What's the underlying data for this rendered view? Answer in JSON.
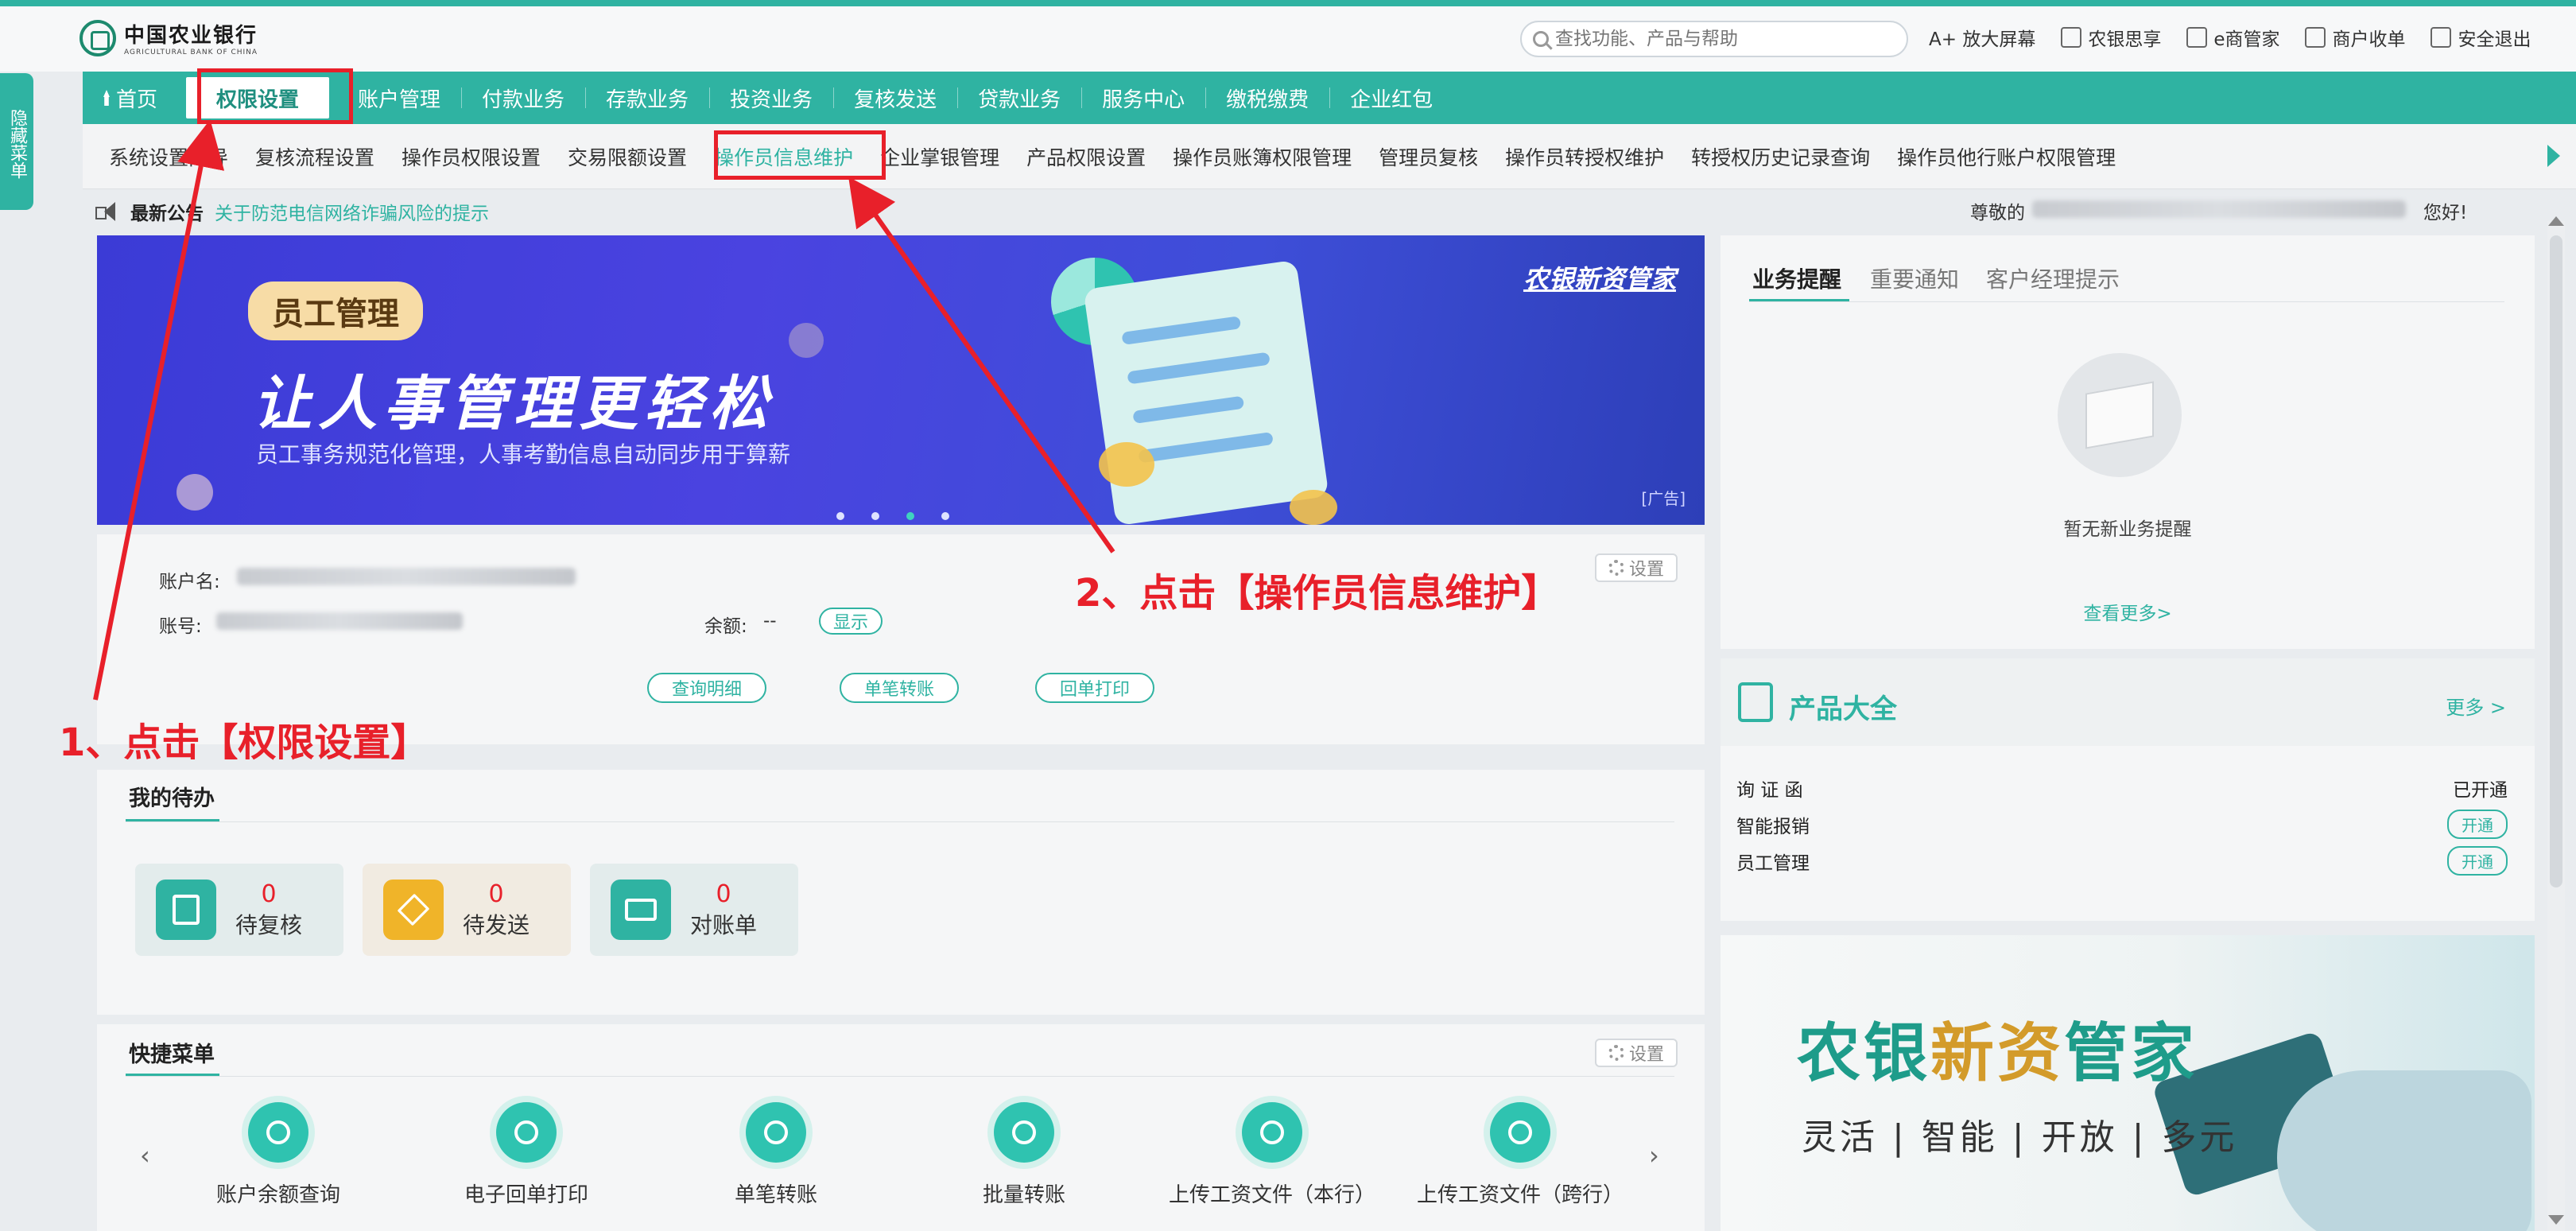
{
  "header": {
    "logo_cn": "中国农业银行",
    "logo_en": "AGRICULTURAL BANK OF CHINA",
    "search_placeholder": "查找功能、产品与帮助",
    "tools": [
      {
        "icon": "font-size-icon",
        "label": "A+ 放大屏幕"
      },
      {
        "icon": "share-icon",
        "label": "农银思享"
      },
      {
        "icon": "e-manager-icon",
        "label": "e商管家"
      },
      {
        "icon": "merchant-icon",
        "label": "商户收单"
      },
      {
        "icon": "logout-icon",
        "label": "安全退出"
      }
    ]
  },
  "side_tab": {
    "label": "隐藏菜单",
    "arrow": "︿"
  },
  "nav": {
    "items": [
      "首页",
      "权限设置",
      "账户管理",
      "付款业务",
      "存款业务",
      "投资业务",
      "复核发送",
      "贷款业务",
      "服务中心",
      "缴税缴费",
      "企业红包"
    ],
    "active_index": 1
  },
  "subnav": {
    "items": [
      "系统设置向导",
      "复核流程设置",
      "操作员权限设置",
      "交易限额设置",
      "操作员信息维护",
      "企业掌银管理",
      "产品权限设置",
      "操作员账簿权限管理",
      "管理员复核",
      "操作员转授权维护",
      "转授权历史记录查询",
      "操作员他行账户权限管理"
    ],
    "active_index": 4
  },
  "notice": {
    "title": "最新公告",
    "text": "关于防范电信网络诈骗风险的提示"
  },
  "banner": {
    "tag": "员工管理",
    "headline": "让人事管理更轻松",
    "subtitle": "员工事务规范化管理，人事考勤信息自动同步用于算薪",
    "brand": "农银新资管家",
    "ad": "[广告]",
    "dots": 4,
    "active_dot": 2
  },
  "account": {
    "name_label": "账户名:",
    "number_label": "账号:",
    "balance_label": "余额:",
    "balance_value": "--",
    "show_label": "显示",
    "settings_label": "设置",
    "buttons": [
      "查询明细",
      "单笔转账",
      "回单打印"
    ]
  },
  "todo": {
    "title": "我的待办",
    "cards": [
      {
        "count": "0",
        "label": "待复核",
        "icon": "review-icon",
        "color": "#2fb3a2",
        "bg": "#e6eeee"
      },
      {
        "count": "0",
        "label": "待发送",
        "icon": "send-icon",
        "color": "#f0b429",
        "bg": "#f4eee4"
      },
      {
        "count": "0",
        "label": "对账单",
        "icon": "statement-icon",
        "color": "#2fb3a2",
        "bg": "#e6eeee"
      }
    ]
  },
  "quick": {
    "title": "快捷菜单",
    "settings_label": "设置",
    "prev": "‹",
    "next": "›",
    "items": [
      "账户余额查询",
      "电子回单打印",
      "单笔转账",
      "批量转账",
      "上传工资文件（本行）",
      "上传工资文件（跨行）"
    ]
  },
  "greeting": {
    "prefix": "尊敬的",
    "suffix": "您好!"
  },
  "biz": {
    "tabs": [
      "业务提醒",
      "重要通知",
      "客户经理提示"
    ],
    "active_index": 0,
    "empty_text": "暂无新业务提醒",
    "more": "查看更多>"
  },
  "products": {
    "title": "产品大全",
    "more": "更多 >",
    "rows": [
      {
        "name": "询 证 函",
        "status": "已开通"
      },
      {
        "name": "智能报销",
        "status": "开通"
      },
      {
        "name": "员工管理",
        "status": "开通"
      }
    ]
  },
  "ad2": {
    "title_a": "农银",
    "title_b": "新资",
    "title_c": "管家",
    "subtitle": "灵活 | 智能 | 开放 | 多元"
  },
  "annotations": {
    "step1": "1、点击【权限设置】",
    "step2": "2、点击【操作员信息维护】"
  }
}
